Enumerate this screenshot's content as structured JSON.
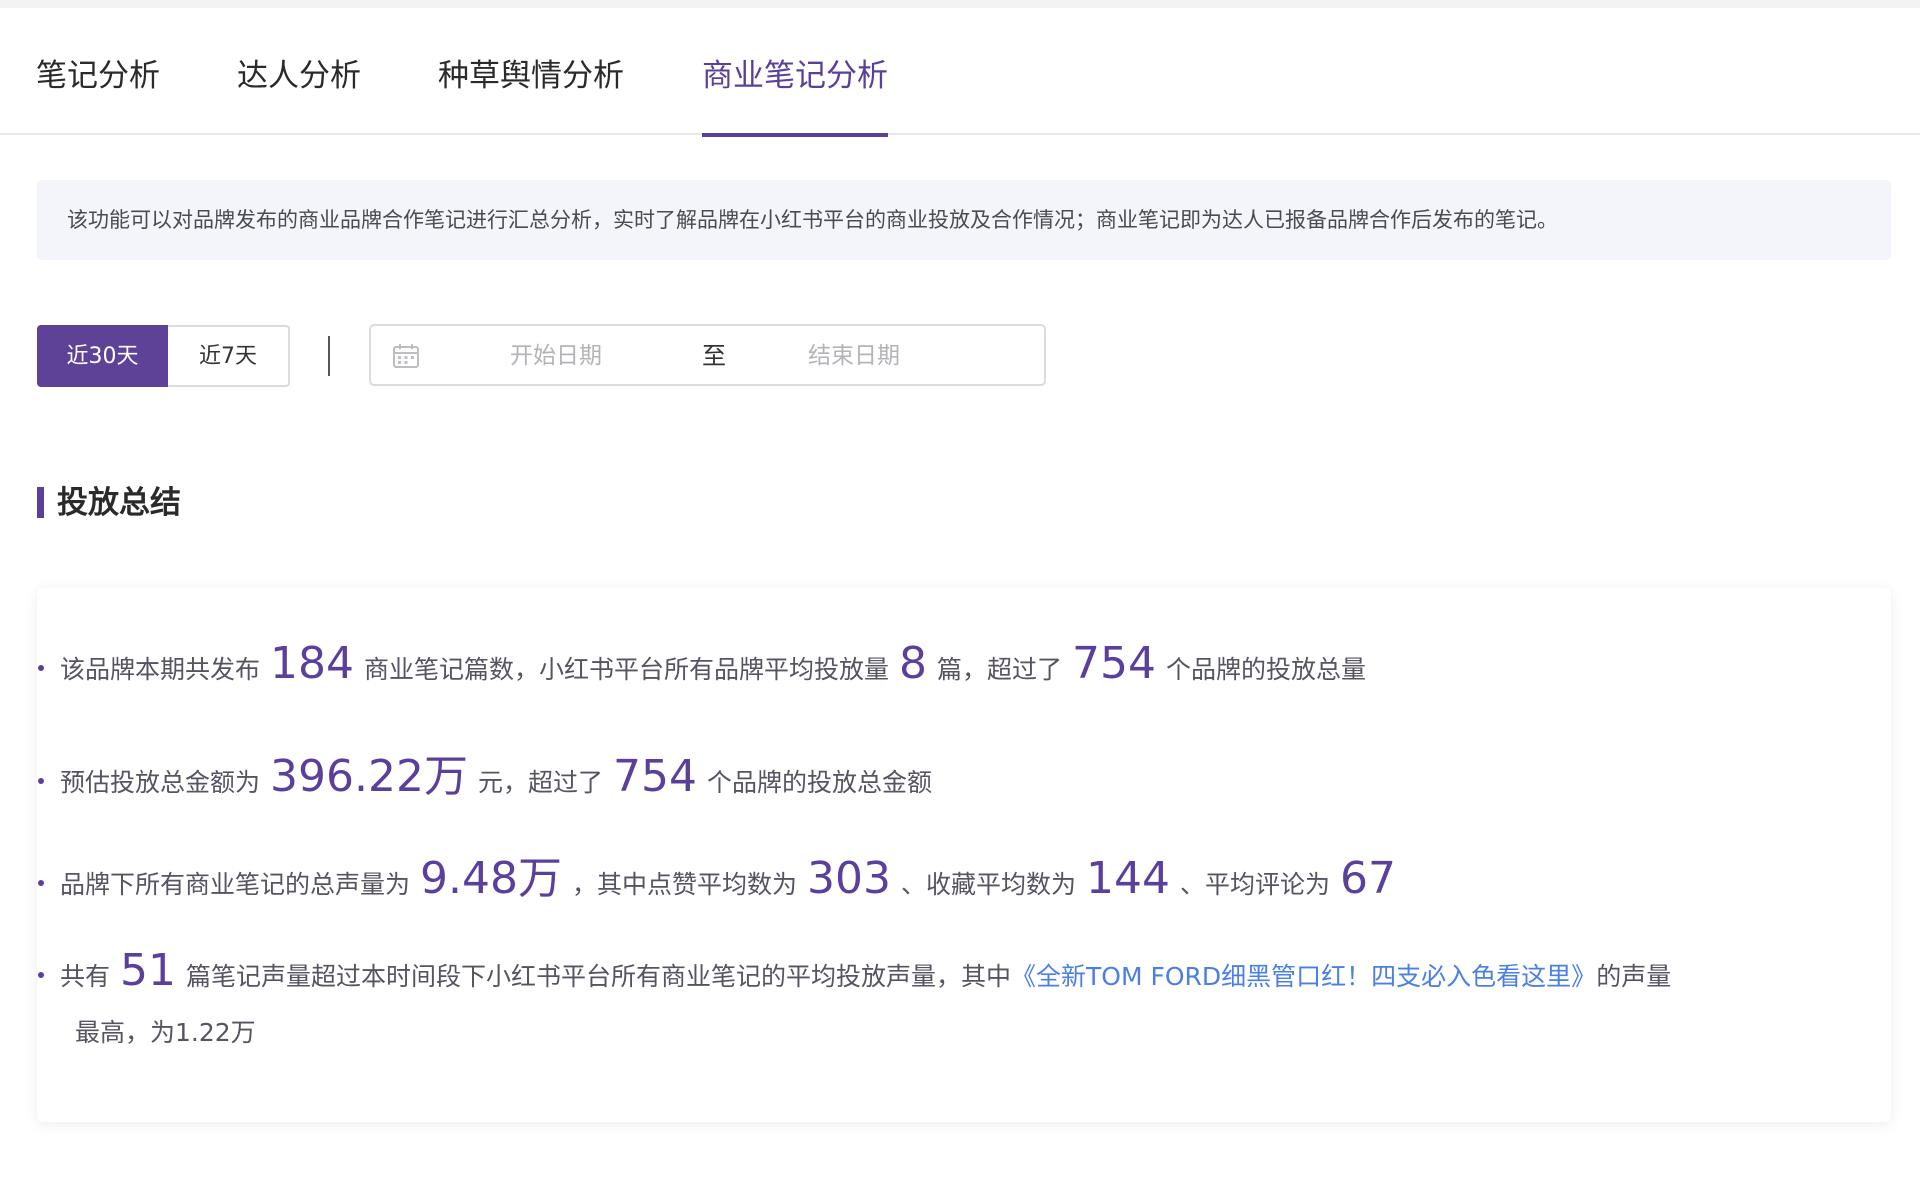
{
  "tabs": [
    {
      "label": "笔记分析"
    },
    {
      "label": "达人分析"
    },
    {
      "label": "种草舆情分析"
    },
    {
      "label": "商业笔记分析"
    }
  ],
  "active_tab": 3,
  "banner": {
    "text": "该功能可以对品牌发布的商业品牌合作笔记进行汇总分析，实时了解品牌在小红书平台的商业投放及合作情况；商业笔记即为达人已报备品牌合作后发布的笔记。"
  },
  "range_buttons": {
    "last30": "近30天",
    "last7": "近7天"
  },
  "date_picker": {
    "start_placeholder": "开始日期",
    "separator": "至",
    "end_placeholder": "结束日期"
  },
  "section": {
    "title": "投放总结"
  },
  "summary": {
    "line1": {
      "t1": "该品牌本期共发布",
      "n1": "184",
      "t2": "商业笔记篇数，小红书平台所有品牌平均投放量",
      "n2": "8",
      "t3": "篇，超过了",
      "n3": "754",
      "t4": "个品牌的投放总量"
    },
    "line2": {
      "t1": "预估投放总金额为",
      "n1": "396.22万",
      "t2": "元，超过了",
      "n2": "754",
      "t3": "个品牌的投放总金额"
    },
    "line3": {
      "t1": "品牌下所有商业笔记的总声量为",
      "n1": "9.48万",
      "t2": "，其中点赞平均数为",
      "n2": "303",
      "t3": "、收藏平均数为",
      "n3": "144",
      "t4": "、平均评论为",
      "n4": "67"
    },
    "line4": {
      "t1": "共有",
      "n1": "51",
      "t2": "篇笔记声量超过本时间段下小红书平台所有商业笔记的平均投放声量，其中",
      "link": "《全新TOM FORD细黑管口红！四支必入色看这里》",
      "t3": "的声量",
      "t4": "最高，为1.22万"
    }
  },
  "colors": {
    "accent": "#5b3f9c",
    "link": "#4a7fe6",
    "banner_bg": "#f4f5fa"
  },
  "icons": {
    "date_picker": "calendar-icon"
  }
}
